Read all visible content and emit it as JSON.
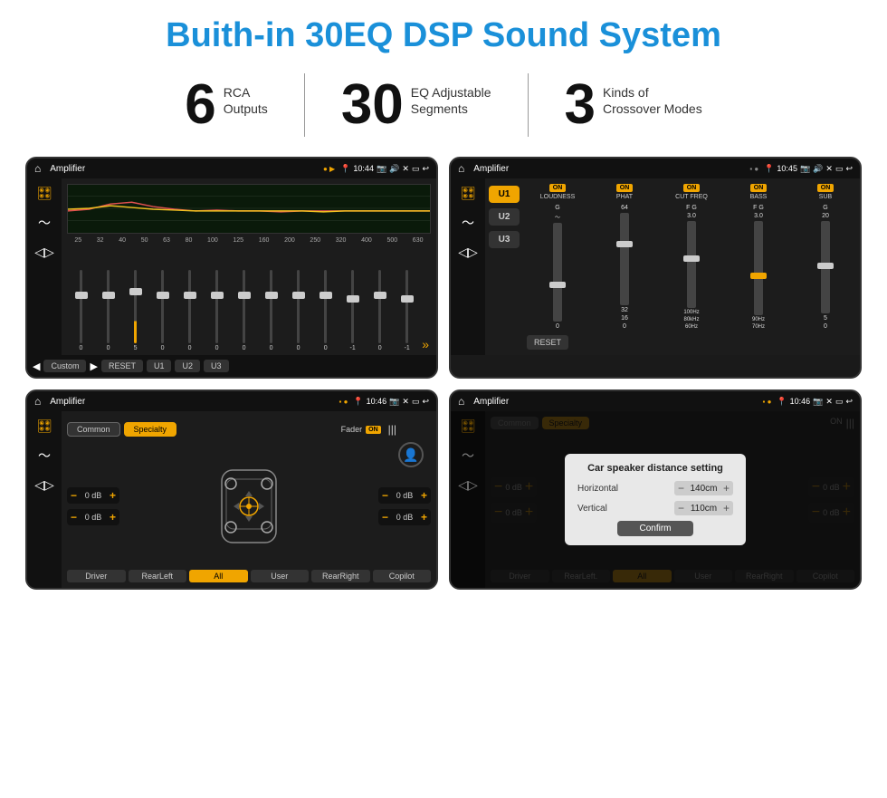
{
  "header": {
    "title": "Buith-in 30EQ DSP Sound System"
  },
  "stats": [
    {
      "number": "6",
      "line1": "RCA",
      "line2": "Outputs"
    },
    {
      "number": "30",
      "line1": "EQ Adjustable",
      "line2": "Segments"
    },
    {
      "number": "3",
      "line1": "Kinds of",
      "line2": "Crossover Modes"
    }
  ],
  "screens": {
    "eq": {
      "status": {
        "title": "Amplifier",
        "time": "10:44"
      },
      "frequencies": [
        "25",
        "32",
        "40",
        "50",
        "63",
        "80",
        "100",
        "125",
        "160",
        "200",
        "250",
        "320",
        "400",
        "500",
        "630"
      ],
      "sliders": [
        {
          "value": "0",
          "pos": 50
        },
        {
          "value": "0",
          "pos": 50
        },
        {
          "value": "5",
          "pos": 40
        },
        {
          "value": "0",
          "pos": 50
        },
        {
          "value": "0",
          "pos": 50
        },
        {
          "value": "0",
          "pos": 50
        },
        {
          "value": "0",
          "pos": 50
        },
        {
          "value": "0",
          "pos": 50
        },
        {
          "value": "0",
          "pos": 50
        },
        {
          "value": "0",
          "pos": 50
        },
        {
          "value": "-1",
          "pos": 55
        },
        {
          "value": "0",
          "pos": 50
        },
        {
          "value": "-1",
          "pos": 55
        }
      ],
      "buttons": [
        "Custom",
        "RESET",
        "U1",
        "U2",
        "U3"
      ]
    },
    "u123": {
      "status": {
        "title": "Amplifier",
        "time": "10:45"
      },
      "uButtons": [
        "U1",
        "U2",
        "U3"
      ],
      "controls": [
        {
          "label": "LOUDNESS",
          "on": true,
          "value": ""
        },
        {
          "label": "PHAT",
          "on": true,
          "value": ""
        },
        {
          "label": "CUT FREQ",
          "on": true,
          "value": ""
        },
        {
          "label": "BASS",
          "on": true,
          "value": ""
        },
        {
          "label": "SUB",
          "on": true,
          "value": ""
        }
      ],
      "resetLabel": "RESET"
    },
    "speaker": {
      "status": {
        "title": "Amplifier",
        "time": "10:46"
      },
      "tabs": [
        "Common",
        "Specialty"
      ],
      "faderLabel": "Fader",
      "faderOn": "ON",
      "volumes": [
        "0 dB",
        "0 dB",
        "0 dB",
        "0 dB"
      ],
      "positions": [
        "Driver",
        "Copilot",
        "RearLeft",
        "All",
        "User",
        "RearRight"
      ]
    },
    "dialog": {
      "status": {
        "title": "Amplifier",
        "time": "10:46"
      },
      "dialogTitle": "Car speaker distance setting",
      "horizontal": {
        "label": "Horizontal",
        "value": "140cm"
      },
      "vertical": {
        "label": "Vertical",
        "value": "110cm"
      },
      "confirmLabel": "Confirm",
      "positions": [
        "Driver",
        "Copilot",
        "RearLeft",
        "All",
        "User",
        "RearRight"
      ]
    }
  }
}
